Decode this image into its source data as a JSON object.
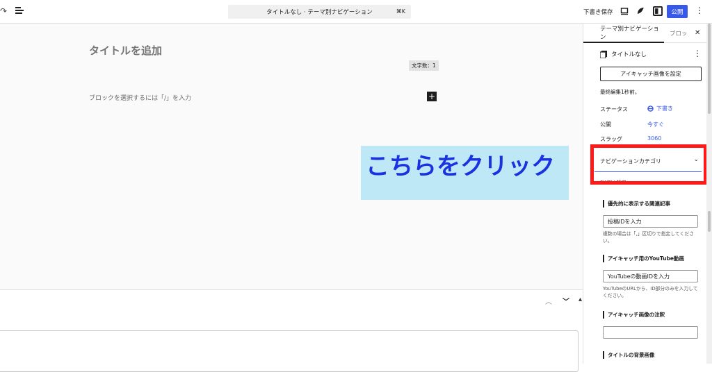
{
  "topbar": {
    "redo_icon": "redo-icon",
    "list_view_icon": "list-view-icon",
    "command_title": "タイトルなし · テーマ別ナビゲーション",
    "command_shortcut": "⌘K",
    "save_draft": "下書き保存",
    "publish": "公開",
    "accent": "#3858e9"
  },
  "editor": {
    "title_placeholder": "タイトルを追加",
    "word_count": "文字数：1",
    "block_placeholder": "ブロックを選択するには「/」を入力",
    "add_block": "+",
    "overlay_text": "こちらをクリック",
    "overlay_bg": "#bfe8f6",
    "overlay_color": "#1a32e0"
  },
  "sidebar": {
    "tabs": [
      {
        "label": "テーマ別ナビゲーション"
      },
      {
        "label": "ブロッ"
      }
    ],
    "doc_title": "タイトルなし",
    "featured_image_button": "アイキャッチ画像を設定",
    "last_edited": "最終編集1秒前。",
    "props": [
      {
        "label": "ステータス",
        "value": "下書き"
      },
      {
        "label": "公開",
        "value": "今すぐ"
      },
      {
        "label": "スラッグ",
        "value": "3060"
      }
    ],
    "nav_category": "ナビゲーションカテゴリ",
    "swell_settings": "SWELL設定",
    "related_label": "優先的に表示する関連記事",
    "related_placeholder": "投稿IDを入力",
    "related_help": "複数の場合は「,」区切りで指定してください。",
    "youtube_label": "アイキャッチ用のYouTube動画",
    "youtube_placeholder": "YouTubeの動画IDを入力",
    "youtube_help": "YouTubeのURLから、ID部分のみを入力してください。",
    "caption_label": "アイキャッチ画像の注釈",
    "caption_value": "",
    "title_bg_label": "タイトルの背景画像",
    "highlight_color": "#ff1a1a"
  }
}
